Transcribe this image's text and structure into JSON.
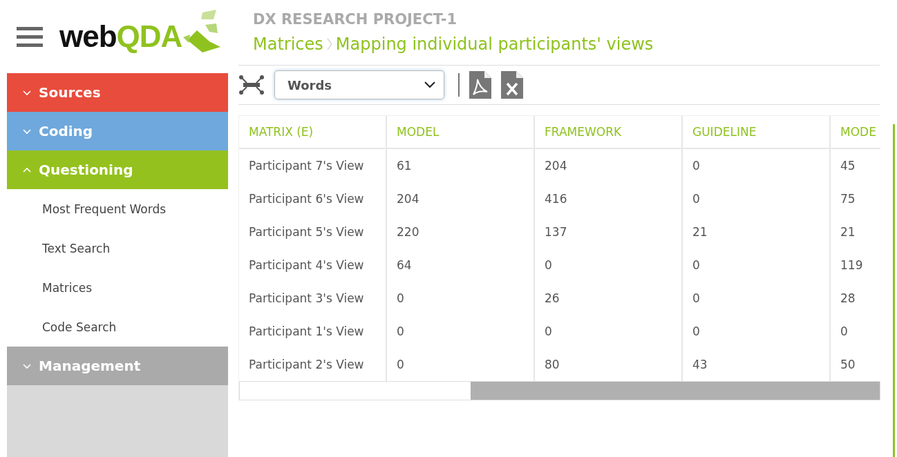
{
  "logo": {
    "dark": "web",
    "accent": "QDA"
  },
  "sidebar": {
    "sections": [
      {
        "label": "Sources",
        "color": "#e84c3d",
        "expanded": false
      },
      {
        "label": "Coding",
        "color": "#6fa8dc",
        "expanded": false
      },
      {
        "label": "Questioning",
        "color": "#95c11f",
        "expanded": true,
        "items": [
          {
            "label": "Most Frequent Words"
          },
          {
            "label": "Text Search"
          },
          {
            "label": "Matrices"
          },
          {
            "label": "Code Search"
          }
        ]
      },
      {
        "label": "Management",
        "color": "#aaaaaa",
        "expanded": false
      }
    ]
  },
  "project_title": "DX RESEARCH PROJECT-1",
  "breadcrumb": [
    "Matrices",
    "Mapping individual participants' views"
  ],
  "toolbar": {
    "dropdown": {
      "value": "Words"
    }
  },
  "table": {
    "columns": [
      "MATRIX (E)",
      "MODEL",
      "FRAMEWORK",
      "GUIDELINE",
      "MODE"
    ],
    "rows": [
      [
        "Participant 7's View",
        "61",
        "204",
        "0",
        "45"
      ],
      [
        "Participant 6's View",
        "204",
        "416",
        "0",
        "75"
      ],
      [
        "Participant 5's View",
        "220",
        "137",
        "21",
        "21"
      ],
      [
        "Participant 4's View",
        "64",
        "0",
        "0",
        "119"
      ],
      [
        "Participant 3's View",
        "0",
        "26",
        "0",
        "28"
      ],
      [
        "Participant 1's View",
        "0",
        "0",
        "0",
        "0"
      ],
      [
        "Participant 2's View",
        "0",
        "80",
        "43",
        "50"
      ]
    ]
  }
}
